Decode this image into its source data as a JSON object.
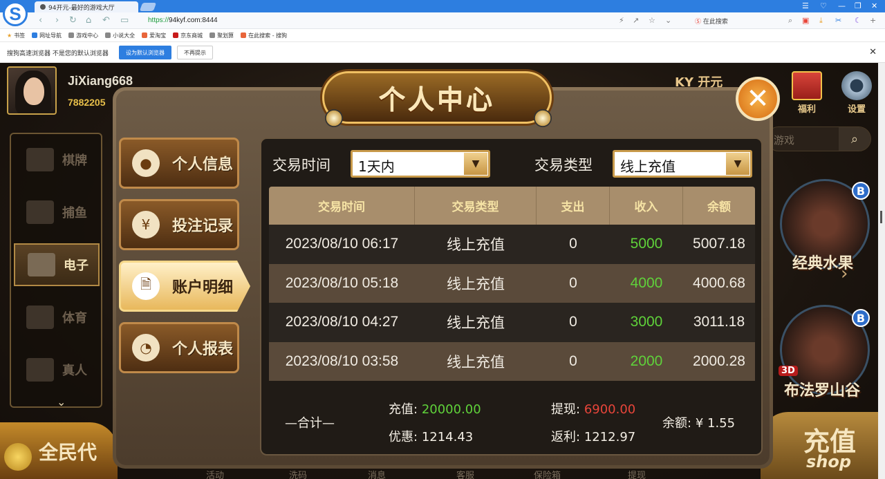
{
  "browser": {
    "tab_title": "94开元-最好的游戏大厅",
    "url_scheme": "https://",
    "url_host": "94kyf.com:8444",
    "search_placeholder": "在此搜索",
    "logo_letter": "S",
    "bookmarks": [
      "书签",
      "网址导航",
      "游戏中心",
      "小说大全",
      "爱淘宝",
      "京东商城",
      "聚划算",
      "在此搜索 - 搜狗"
    ],
    "infobar_msg": "搜狗高速浏览器 不是您的默认浏览器",
    "set_default_label": "设为默认浏览器",
    "no_more_label": "不再提示"
  },
  "game": {
    "username": "JiXiang668",
    "user_id": "7882205",
    "brand": "KY 开元",
    "welfare_label": "福利",
    "settings_label": "设置",
    "search_placeholder": "游戏",
    "side_nav": [
      {
        "label": "棋牌"
      },
      {
        "label": "捕鱼"
      },
      {
        "label": "电子"
      },
      {
        "label": "体育"
      },
      {
        "label": "真人"
      }
    ],
    "tiles": [
      {
        "label": "经典水果",
        "badge": "B"
      },
      {
        "label": "布法罗山谷",
        "badge": "B",
        "tag": "3D"
      }
    ],
    "promo_label": "全民代",
    "shop_label": "充值",
    "shop_sub": "shop",
    "bottom_nav": [
      "活动",
      "洗码",
      "消息",
      "客服",
      "保险箱",
      "提现"
    ]
  },
  "modal": {
    "title": "个人中心",
    "menu": [
      {
        "label": "个人信息",
        "icon": "person-icon"
      },
      {
        "label": "投注记录",
        "icon": "ticket-icon"
      },
      {
        "label": "账户明细",
        "icon": "document-search-icon"
      },
      {
        "label": "个人报表",
        "icon": "pie-chart-icon"
      }
    ],
    "filters": {
      "time_label": "交易时间",
      "time_value": "1天内",
      "type_label": "交易类型",
      "type_value": "线上充值"
    },
    "table": {
      "headers": [
        "交易时间",
        "交易类型",
        "支出",
        "收入",
        "余额"
      ],
      "rows": [
        [
          "2023/08/10 06:17",
          "线上充值",
          "0",
          "5000",
          "5007.18"
        ],
        [
          "2023/08/10 05:18",
          "线上充值",
          "0",
          "4000",
          "4000.68"
        ],
        [
          "2023/08/10 04:27",
          "线上充值",
          "0",
          "3000",
          "3011.18"
        ],
        [
          "2023/08/10 03:58",
          "线上充值",
          "0",
          "2000",
          "2000.28"
        ]
      ]
    },
    "summary": {
      "label": "—合计—",
      "recharge_label": "充值:",
      "recharge_value": "20000.00",
      "discount_label": "优惠:",
      "discount_value": "1214.43",
      "withdraw_label": "提现:",
      "withdraw_value": "6900.00",
      "rebate_label": "返利:",
      "rebate_value": "1212.97",
      "balance_label": "余额:",
      "balance_value": "¥ 1.55"
    }
  },
  "colors": {
    "browser_blue": "#2d7ee0",
    "income_green": "#5fd23a",
    "withdraw_red": "#e8453a",
    "header_gold": "#f6e3a5"
  }
}
